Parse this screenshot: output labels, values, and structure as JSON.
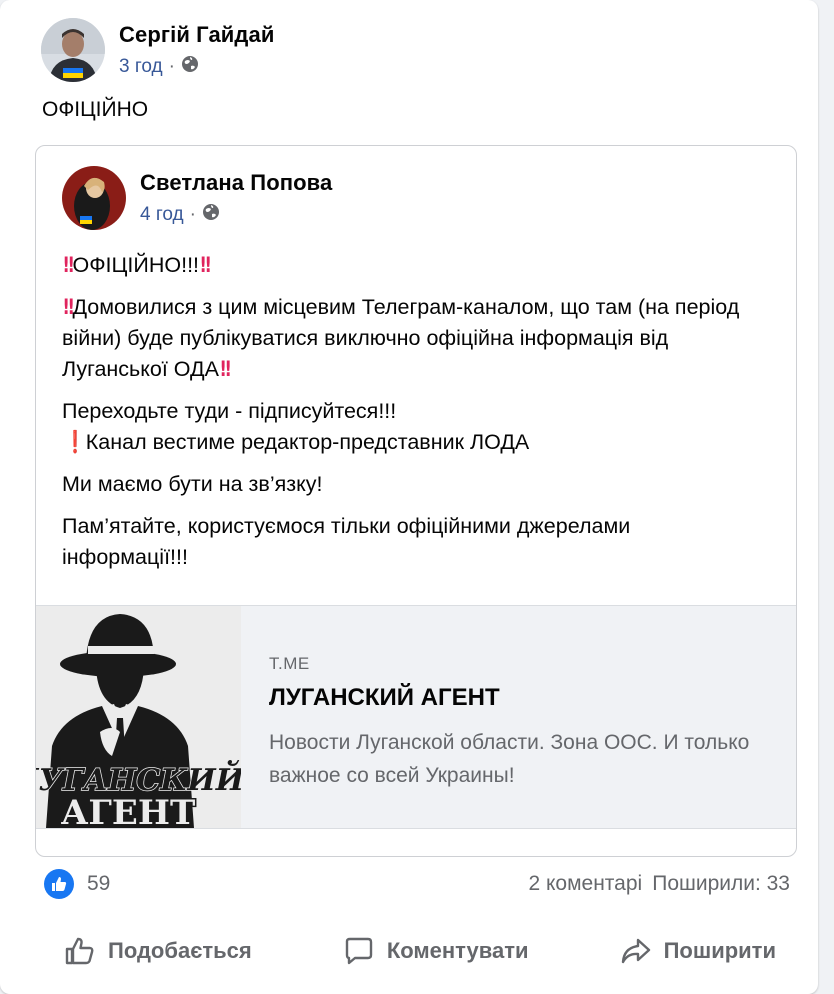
{
  "post": {
    "author": "Сергій Гайдай",
    "time": "3 год",
    "text": "ОФІЦІЙНО"
  },
  "shared": {
    "author": "Светлана Попова",
    "time": "4 год",
    "line1": "ОФІЦІЙНО!!!",
    "line2": "Домовилися з цим місцевим Телеграм-каналом, що там (на період війни) буде публікуватися виключно офіційна інформація від Луганської ОДА",
    "line3": "Переходьте туди - підписуйтеся!!!",
    "line4": "Канал вестиме редактор-представник ЛОДА",
    "line5": "Ми маємо бути на зв’язку!",
    "line6": "Пам’ятайте, користуємося тільки офіційними джерелами інформації!!!"
  },
  "link": {
    "domain": "T.ME",
    "title": "ЛУГАНСКИЙ АГЕНТ",
    "description": "Новости Луганской области. Зона ООС. И только важное со всей Украины!",
    "logo_line1": "ЛУГАНСКИЙ",
    "logo_line2": "АГЕНТ"
  },
  "stats": {
    "likes": "59",
    "comments": "2 коментарі",
    "shares": "Поширили: 33"
  },
  "actions": {
    "like": "Подобається",
    "comment": "Коментувати",
    "share": "Поширити"
  },
  "colors": {
    "accent": "#1877f2",
    "link": "#385898",
    "secondary": "#65676b",
    "exclamation": "#e0245e"
  },
  "icons": [
    "globe-icon",
    "double-exclamation-icon",
    "exclamation-icon",
    "like-icon",
    "comment-icon",
    "share-icon"
  ]
}
